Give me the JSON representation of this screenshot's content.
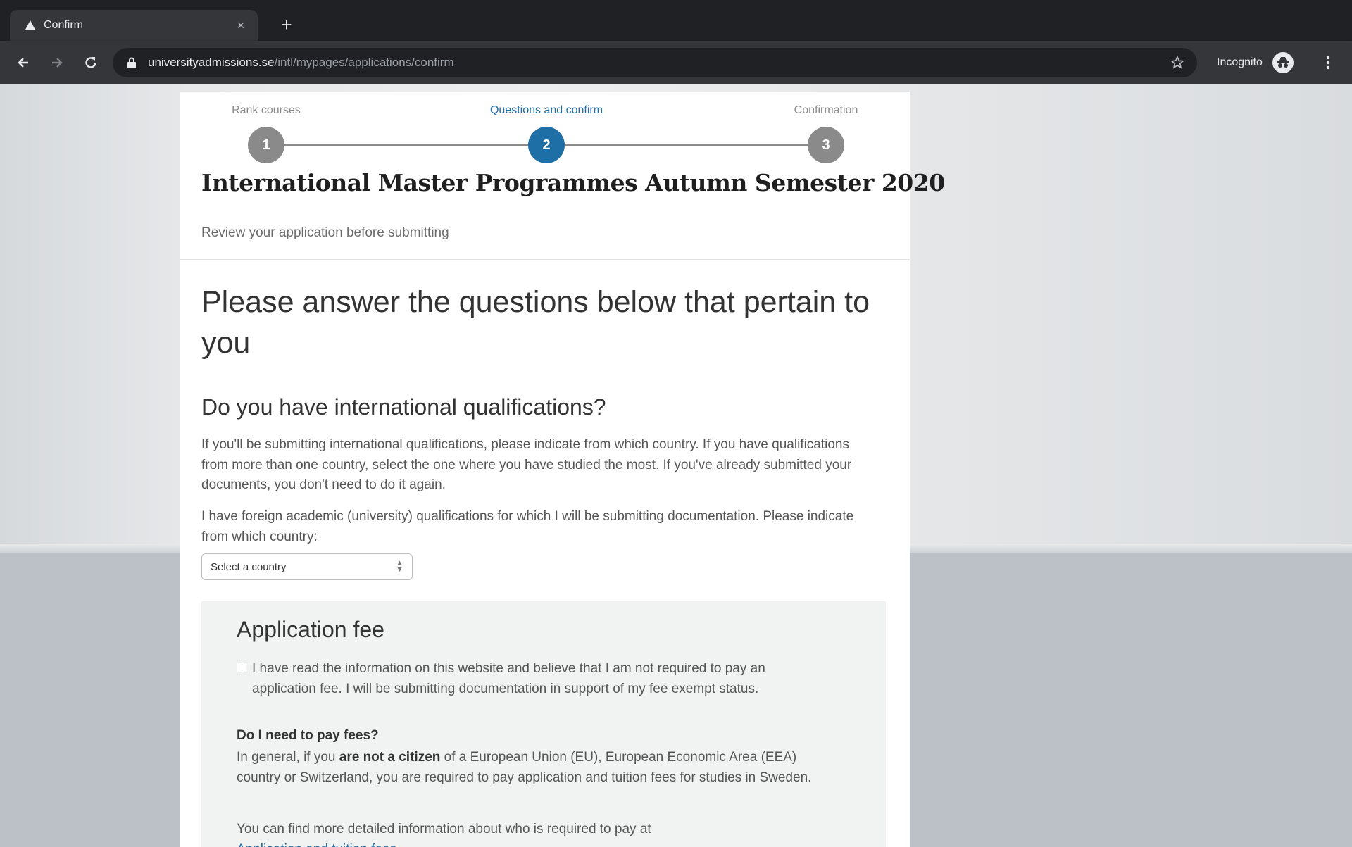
{
  "browser": {
    "tab_title": "Confirm",
    "tab_close_glyph": "×",
    "new_tab_glyph": "+",
    "url_host": "universityadmissions.se",
    "url_path": "/intl/mypages/applications/confirm",
    "profile_label": "Incognito",
    "colors": {
      "frame": "#202124",
      "toolbar": "#35363a",
      "text": "#e8eaed"
    }
  },
  "stepper": {
    "steps": [
      {
        "label": "Rank courses",
        "number": "1",
        "state": "done"
      },
      {
        "label": "Questions and confirm",
        "number": "2",
        "state": "active"
      },
      {
        "label": "Confirmation",
        "number": "3",
        "state": "pending"
      }
    ],
    "colors": {
      "active": "#1d6fa5",
      "inactive": "#8a8a8a"
    }
  },
  "page": {
    "title": "International Master Programmes Autumn Semester 2020",
    "subtitle": "Review your application before submitting",
    "main_question": "Please answer the questions below that pertain to you"
  },
  "international": {
    "heading": "Do you have international qualifications?",
    "description": "If you'll be submitting international qualifications, please indicate from which country. If you have qualifications from more than one country, select the one where you have studied the most. If you've already submitted your documents, you don't need to do it again.",
    "question": "I have foreign academic (university) qualifications for which I will be submitting documentation. Please indicate from which country:",
    "select_value": "Select a country"
  },
  "application_fee": {
    "heading": "Application fee",
    "checkbox_label": "I have read the information on this website and believe that I am not required to pay an application fee. I will be submitting documentation in support of my fee exempt status.",
    "checkbox_checked": false,
    "question": "Do I need to pay fees?",
    "body_prefix": "In general, if you ",
    "body_bold": "are not a citizen",
    "body_suffix": " of a European Union (EU), European Economic Area (EEA) country or Switzerland, you are required to pay application and tuition fees for studies in Sweden.",
    "more_info": "You can find more detailed information about who is required to pay at",
    "link_text": "Application and tuition fees"
  },
  "icons": {
    "favicon": "university-favicon-icon",
    "back": "arrow-back-icon",
    "forward": "arrow-forward-icon",
    "reload": "reload-icon",
    "lock": "lock-icon",
    "bookmark": "star-icon",
    "incognito": "incognito-icon",
    "menu": "kebab-menu-icon"
  }
}
